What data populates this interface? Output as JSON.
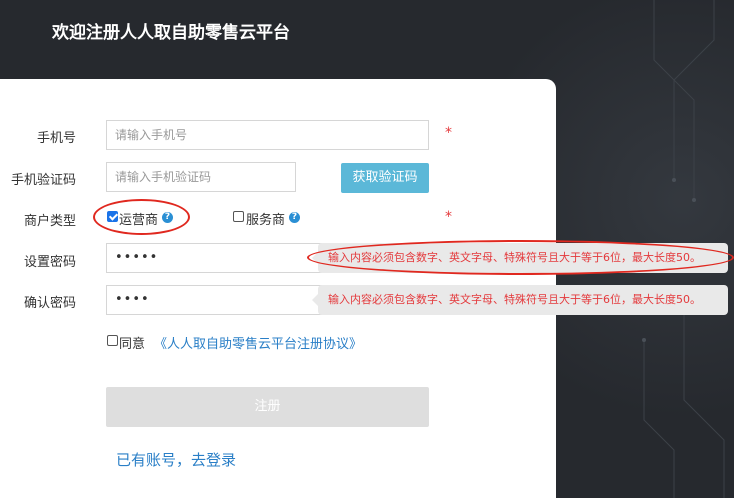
{
  "header": {
    "title": "欢迎注册人人取自助零售云平台"
  },
  "form": {
    "phone": {
      "label": "手机号",
      "placeholder": "请输入手机号",
      "required": "*"
    },
    "code": {
      "label": "手机验证码",
      "placeholder": "请输入手机验证码",
      "button": "获取验证码"
    },
    "merchant_type": {
      "label": "商户类型",
      "required": "*",
      "options": [
        {
          "label": "运营商",
          "checked": true,
          "help": "?"
        },
        {
          "label": "服务商",
          "checked": false,
          "help": "?"
        }
      ]
    },
    "password": {
      "label": "设置密码",
      "value": "•••••",
      "tooltip": "输入内容必须包含数字、英文字母、特殊符号且大于等于6位，最大长度50。"
    },
    "confirm": {
      "label": "确认密码",
      "value": "••••",
      "tooltip": "输入内容必须包含数字、英文字母、特殊符号且大于等于6位，最大长度50。"
    },
    "agree": {
      "label": "同意",
      "link": "《人人取自助零售云平台注册协议》",
      "checked": false
    },
    "register_button": "注册",
    "login_link": "已有账号，去登录"
  },
  "colors": {
    "background": "#26292e",
    "accent": "#5bb8d8",
    "error": "#e4393c",
    "link": "#2a7fc7",
    "annotation": "#e0281f"
  }
}
